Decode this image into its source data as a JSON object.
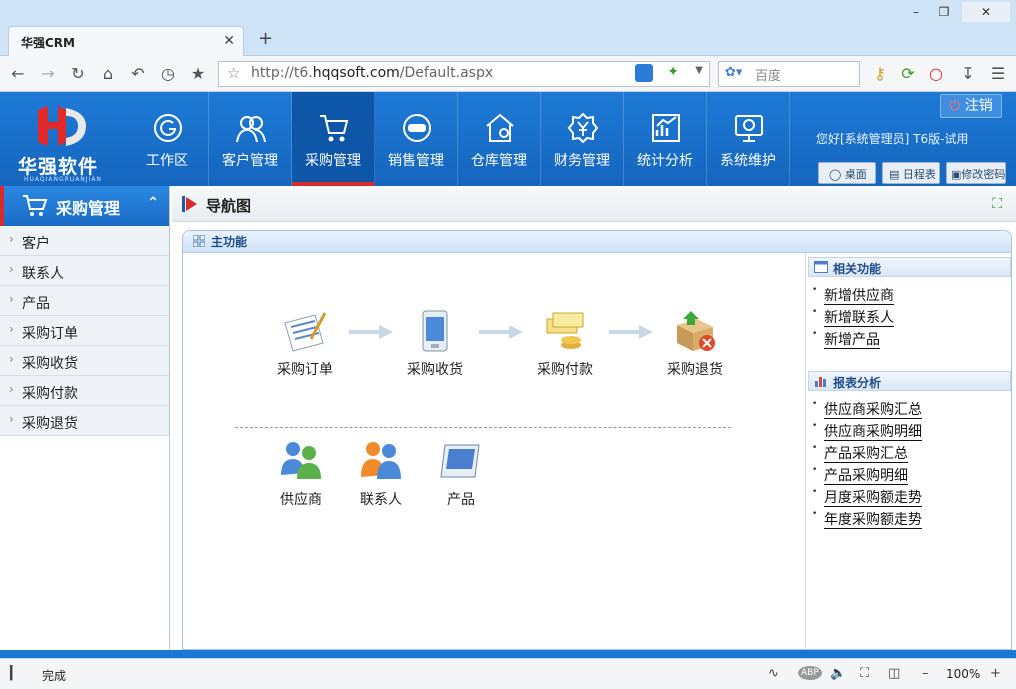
{
  "browser": {
    "tab_title": "华强CRM",
    "url_prefix": "http://t6.",
    "url_domain": "hqqsoft.com",
    "url_path": "/Default.aspx",
    "search_placeholder": "百度",
    "status_text": "完成",
    "zoom_level": "100%"
  },
  "logo": {
    "text": "华强软件",
    "subtext": "HUAQIANGRUANJIAN"
  },
  "nav": [
    {
      "label": "工作区",
      "icon": "workspace-icon"
    },
    {
      "label": "客户管理",
      "icon": "customers-icon"
    },
    {
      "label": "采购管理",
      "icon": "cart-icon"
    },
    {
      "label": "销售管理",
      "icon": "sale-icon"
    },
    {
      "label": "仓库管理",
      "icon": "warehouse-icon"
    },
    {
      "label": "财务管理",
      "icon": "finance-icon"
    },
    {
      "label": "统计分析",
      "icon": "stats-icon"
    },
    {
      "label": "系统维护",
      "icon": "maintenance-icon"
    }
  ],
  "header": {
    "logout_label": "注销",
    "welcome": "您好[系统管理员] T6版-试用",
    "desktop_label": "桌面",
    "schedule_label": "日程表",
    "change_pwd_label": "修改密码"
  },
  "sidebar": {
    "title": "采购管理",
    "items": [
      "客户",
      "联系人",
      "产品",
      "采购订单",
      "采购收货",
      "采购付款",
      "采购退货"
    ]
  },
  "main": {
    "title": "导航图",
    "panel_title": "主功能",
    "flow": [
      "采购订单",
      "采购收货",
      "采购付款",
      "采购退货"
    ],
    "secondary": [
      "供应商",
      "联系人",
      "产品"
    ]
  },
  "related": {
    "title": "相关功能",
    "links": [
      "新增供应商",
      "新增联系人",
      "新增产品"
    ]
  },
  "reports": {
    "title": "报表分析",
    "links": [
      "供应商采购汇总",
      "供应商采购明细",
      "产品采购汇总",
      "产品采购明细",
      "月度采购额走势",
      "年度采购额走势"
    ]
  },
  "colors": {
    "header_blue": "#1a6fcb",
    "active_nav": "#0e56a8",
    "accent_red": "#d62b2b"
  }
}
